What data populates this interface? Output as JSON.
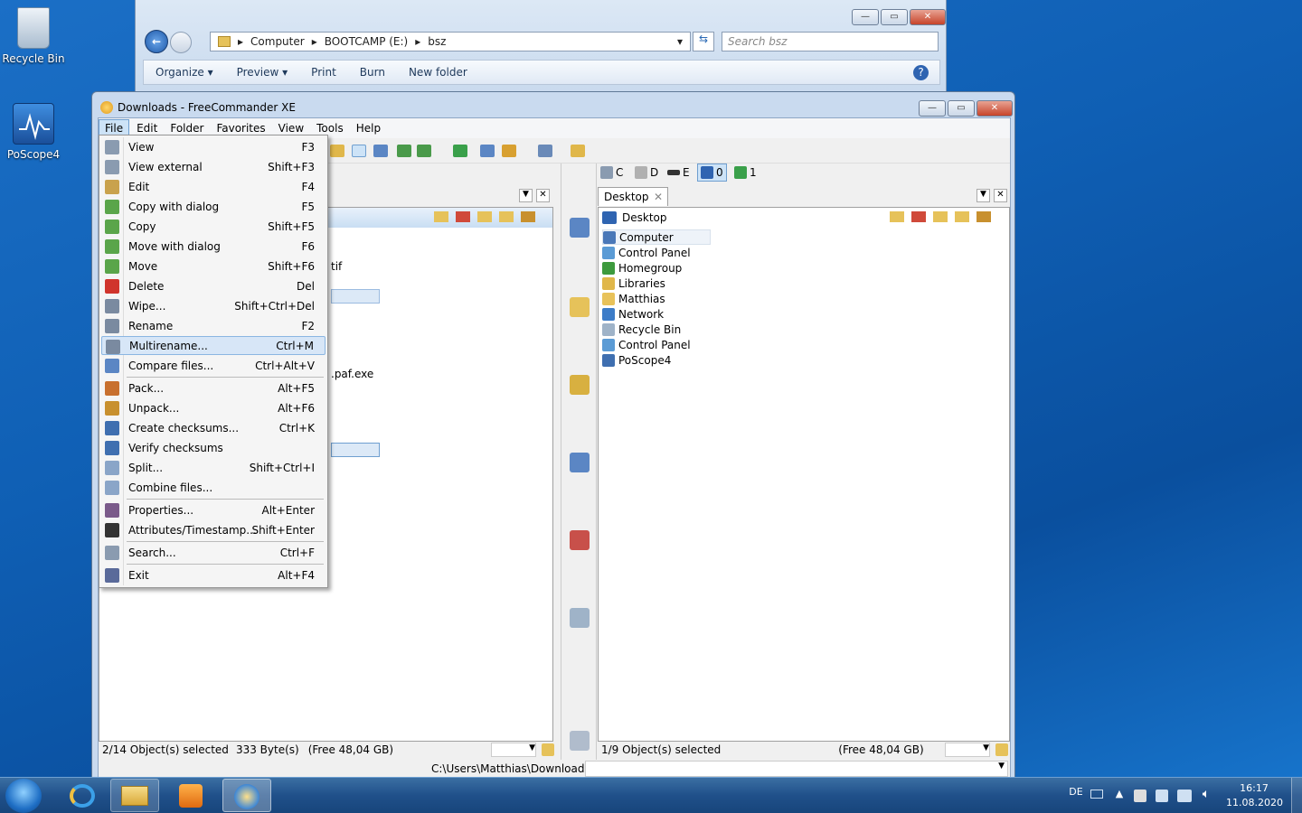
{
  "desktop": {
    "icons": [
      {
        "label": "Recycle Bin",
        "icon": "recycle-bin-icon"
      },
      {
        "label": "PoScope4",
        "icon": "poscope-icon"
      }
    ]
  },
  "explorer": {
    "caption_buttons": {
      "minimize": "—",
      "maximize": "▭",
      "close": "✕"
    },
    "breadcrumb": [
      "Computer",
      "BOOTCAMP (E:)",
      "bsz"
    ],
    "search_placeholder": "Search bsz",
    "toolbar": [
      "Organize ▾",
      "Preview ▾",
      "Print",
      "Burn",
      "New folder"
    ]
  },
  "freecommander": {
    "title": "Downloads - FreeCommander XE",
    "caption_buttons": {
      "minimize": "—",
      "maximize": "▭",
      "close": "✕"
    },
    "menubar": [
      "File",
      "Edit",
      "Folder",
      "Favorites",
      "View",
      "Tools",
      "Help"
    ],
    "active_menu": "File",
    "left_panel": {
      "partial_items": [
        "tif",
        ".paf.exe"
      ],
      "status": {
        "selected": "2/14 Object(s) selected",
        "size": "333 Byte(s)",
        "free": "(Free 48,04 GB)"
      },
      "path": "C:\\Users\\Matthias\\Downloads\\"
    },
    "right_panel": {
      "drives": [
        {
          "letter": "C",
          "icon": "drive-c-icon"
        },
        {
          "letter": "D",
          "icon": "drive-d-icon"
        },
        {
          "letter": "E",
          "icon": "drive-e-icon"
        },
        {
          "letter": "0",
          "icon": "desktop-drive-icon"
        },
        {
          "letter": "1",
          "icon": "network-drive-icon"
        }
      ],
      "tab": "Desktop",
      "path_label": "Desktop",
      "items": [
        {
          "name": "Computer",
          "icon": "computer-icon",
          "color": "#4a78b8"
        },
        {
          "name": "Control Panel",
          "icon": "control-panel-icon",
          "color": "#5b9bd5"
        },
        {
          "name": "Homegroup",
          "icon": "homegroup-icon",
          "color": "#3d9a3d"
        },
        {
          "name": "Libraries",
          "icon": "libraries-icon",
          "color": "#e0b74a"
        },
        {
          "name": "Matthias",
          "icon": "user-folder-icon",
          "color": "#e8c25a"
        },
        {
          "name": "Network",
          "icon": "network-icon",
          "color": "#3c7cc8"
        },
        {
          "name": "Recycle Bin",
          "icon": "recycle-bin-icon",
          "color": "#9fb3c8"
        },
        {
          "name": "Control Panel",
          "icon": "control-panel-icon",
          "color": "#5b9bd5"
        },
        {
          "name": "PoScope4",
          "icon": "poscope-icon",
          "color": "#3f6fb0"
        }
      ],
      "status": {
        "selected": "1/9 Object(s) selected",
        "free": "(Free 48,04 GB)"
      }
    }
  },
  "file_menu": {
    "items": [
      {
        "label": "View",
        "shortcut": "F3",
        "icon": "view-icon",
        "color": "#8a9bb0"
      },
      {
        "label": "View external",
        "shortcut": "Shift+F3",
        "icon": "view-external-icon",
        "color": "#8a9bb0"
      },
      {
        "label": "Edit",
        "shortcut": "F4",
        "icon": "edit-icon",
        "color": "#c9a24d"
      },
      {
        "label": "Copy with dialog",
        "shortcut": "F5",
        "icon": "copy-dialog-icon",
        "color": "#5aa54a"
      },
      {
        "label": "Copy",
        "shortcut": "Shift+F5",
        "icon": "copy-icon",
        "color": "#5aa54a"
      },
      {
        "label": "Move with dialog",
        "shortcut": "F6",
        "icon": "move-dialog-icon",
        "color": "#5aa54a"
      },
      {
        "label": "Move",
        "shortcut": "Shift+F6",
        "icon": "move-icon",
        "color": "#5aa54a"
      },
      {
        "label": "Delete",
        "shortcut": "Del",
        "icon": "delete-icon",
        "color": "#d0342c"
      },
      {
        "label": "Wipe...",
        "shortcut": "Shift+Ctrl+Del",
        "icon": "wipe-icon",
        "color": "#7a8aa0"
      },
      {
        "label": "Rename",
        "shortcut": "F2",
        "icon": "rename-icon",
        "color": "#7a8aa0"
      },
      {
        "label": "Multirename...",
        "shortcut": "Ctrl+M",
        "icon": "multirename-icon",
        "color": "#7a8aa0"
      },
      {
        "label": "Compare files...",
        "shortcut": "Ctrl+Alt+V",
        "icon": "compare-icon",
        "color": "#5b86c4"
      },
      {
        "label": "Pack...",
        "shortcut": "Alt+F5",
        "icon": "pack-icon",
        "color": "#c8702e"
      },
      {
        "label": "Unpack...",
        "shortcut": "Alt+F6",
        "icon": "unpack-icon",
        "color": "#c8902e"
      },
      {
        "label": "Create checksums...",
        "shortcut": "Ctrl+K",
        "icon": "checksum-create-icon",
        "color": "#3f6fb0"
      },
      {
        "label": "Verify checksums",
        "shortcut": "",
        "icon": "checksum-verify-icon",
        "color": "#3f6fb0"
      },
      {
        "label": "Split...",
        "shortcut": "Shift+Ctrl+I",
        "icon": "split-icon",
        "color": "#8aa5c8"
      },
      {
        "label": "Combine files...",
        "shortcut": "",
        "icon": "combine-icon",
        "color": "#8aa5c8"
      },
      {
        "label": "Properties...",
        "shortcut": "Alt+Enter",
        "icon": "properties-icon",
        "color": "#7a5a8a"
      },
      {
        "label": "Attributes/Timestamp...",
        "shortcut": "Shift+Enter",
        "icon": "attributes-icon",
        "color": "#333333"
      },
      {
        "label": "Search...",
        "shortcut": "Ctrl+F",
        "icon": "search-icon",
        "color": "#8a9bb0"
      },
      {
        "label": "Exit",
        "shortcut": "Alt+F4",
        "icon": "exit-icon",
        "color": "#5a6a9a"
      }
    ],
    "highlighted": "Multirename..."
  },
  "taskbar": {
    "language": "DE",
    "time": "16:17",
    "date": "11.08.2020"
  }
}
